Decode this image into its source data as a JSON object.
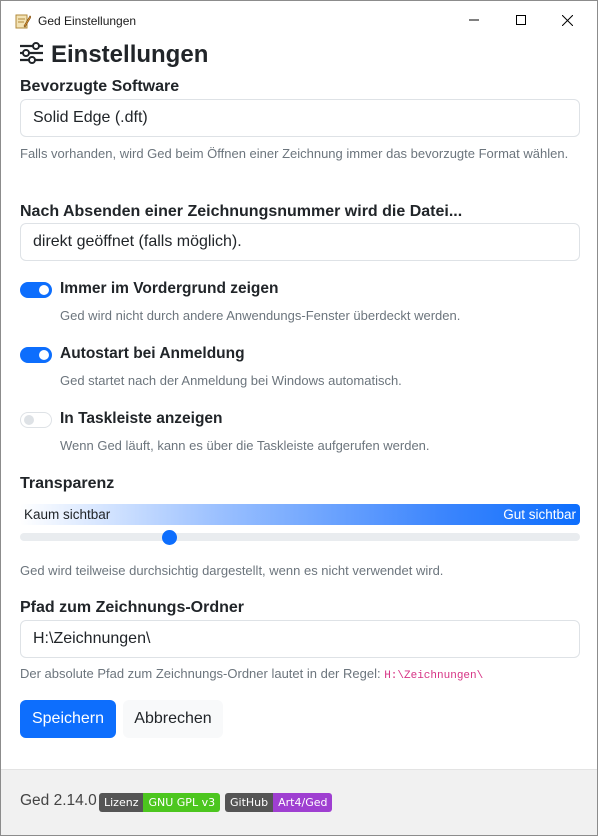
{
  "window": {
    "title": "Ged Einstellungen",
    "icon": "pencil-icon"
  },
  "page": {
    "title": "Einstellungen",
    "icon": "sliders-icon"
  },
  "preferred_software": {
    "label": "Bevorzugte Software",
    "value": "Solid Edge (.dft)",
    "help": "Falls vorhanden, wird Ged beim Öffnen einer Zeichnung immer das bevorzugte Format wählen."
  },
  "after_submit": {
    "label": "Nach Absenden einer Zeichnungsnummer wird die Datei...",
    "value": "direkt geöffnet (falls möglich)."
  },
  "switches": [
    {
      "label": "Immer im Vordergrund zeigen",
      "help": "Ged wird nicht durch andere Anwendungs-Fenster überdeckt werden.",
      "checked": true
    },
    {
      "label": "Autostart bei Anmeldung",
      "help": "Ged startet nach der Anmeldung bei Windows automatisch.",
      "checked": true
    },
    {
      "label": "In Taskleiste anzeigen",
      "help": "Wenn Ged läuft, kann es über die Taskleiste aufgerufen werden.",
      "checked": false
    }
  ],
  "transparency": {
    "label": "Transparenz",
    "left_label": "Kaum sichtbar",
    "right_label": "Gut sichtbar",
    "value": 0.26,
    "help": "Ged wird teilweise durchsichtig dargestellt, wenn es nicht verwendet wird.",
    "accent": "#0d6efd"
  },
  "drawing_folder": {
    "label": "Pfad zum Zeichnungs-Ordner",
    "value": "H:\\Zeichnungen\\",
    "help_prefix": "Der absolute Pfad zum Zeichnungs-Ordner lautet in der Regel: ",
    "help_code": "H:\\Zeichnungen\\"
  },
  "buttons": {
    "save": "Speichern",
    "cancel": "Abbrechen"
  },
  "footer": {
    "version": "Ged 2.14.0",
    "license_badge": {
      "left": "Lizenz",
      "right": "GNU GPL v3",
      "color": "#4cc61e"
    },
    "github_badge": {
      "left": "GitHub",
      "right": "Art4/Ged",
      "color": "#9f3fd1"
    }
  }
}
